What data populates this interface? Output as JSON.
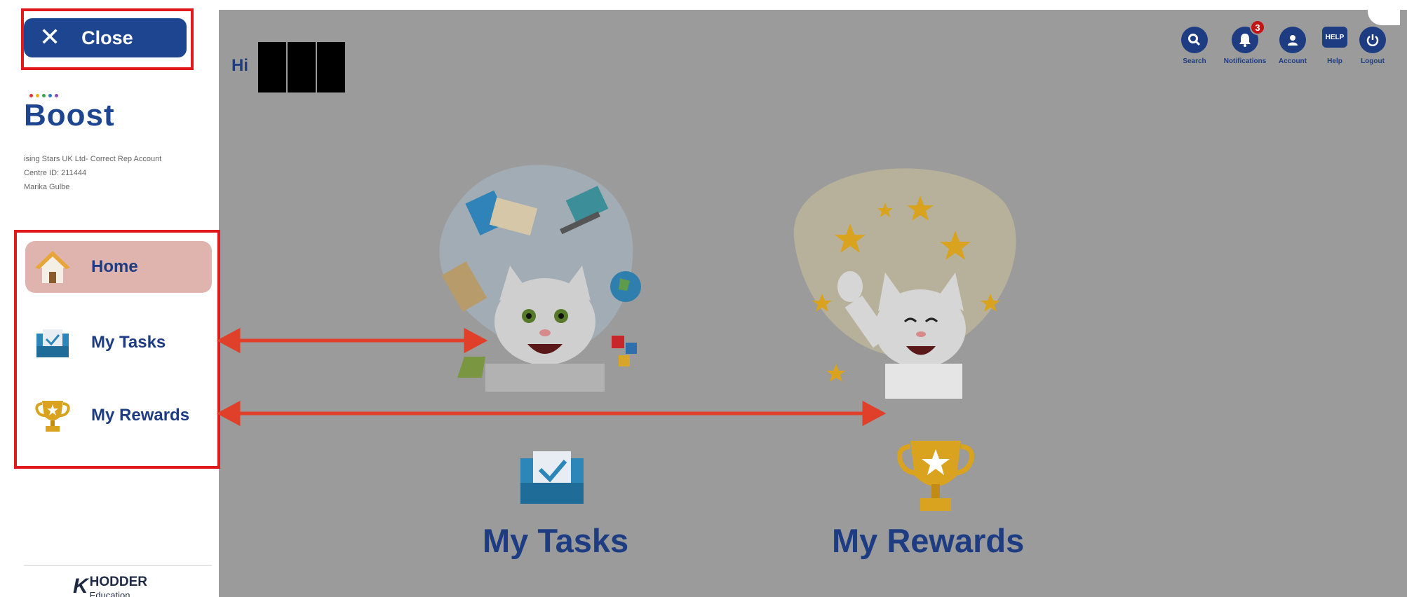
{
  "sidebar": {
    "close_label": "Close",
    "brand_name": "Boost",
    "brand_info": [
      "ising Stars UK Ltd- Correct Rep Account",
      "Centre ID: 211444",
      "Marika Gulbe"
    ],
    "nav": [
      {
        "label": "Home",
        "icon": "home-icon",
        "active": true
      },
      {
        "label": "My Tasks",
        "icon": "tasks-tray-icon",
        "active": false
      },
      {
        "label": "My Rewards",
        "icon": "trophy-icon",
        "active": false
      }
    ],
    "publisher": {
      "name": "HODDER",
      "sub": "Education"
    }
  },
  "header": {
    "greeting": "Hi",
    "notification_count": "3",
    "icons": [
      {
        "label": "Search",
        "icon": "search-icon"
      },
      {
        "label": "Notifications",
        "icon": "bell-icon"
      },
      {
        "label": "Account",
        "icon": "account-icon"
      },
      {
        "label": "Help",
        "icon": "help-icon"
      },
      {
        "label": "Logout",
        "icon": "power-icon"
      }
    ]
  },
  "tiles": {
    "tasks_label": "My Tasks",
    "rewards_label": "My Rewards"
  },
  "colors": {
    "brand_navy": "#1e3c82",
    "close_button": "#1e4690",
    "active_nav": "#dfb4ae",
    "overlay": "#9b9b9b",
    "annotation_red": "#e01a1a"
  }
}
